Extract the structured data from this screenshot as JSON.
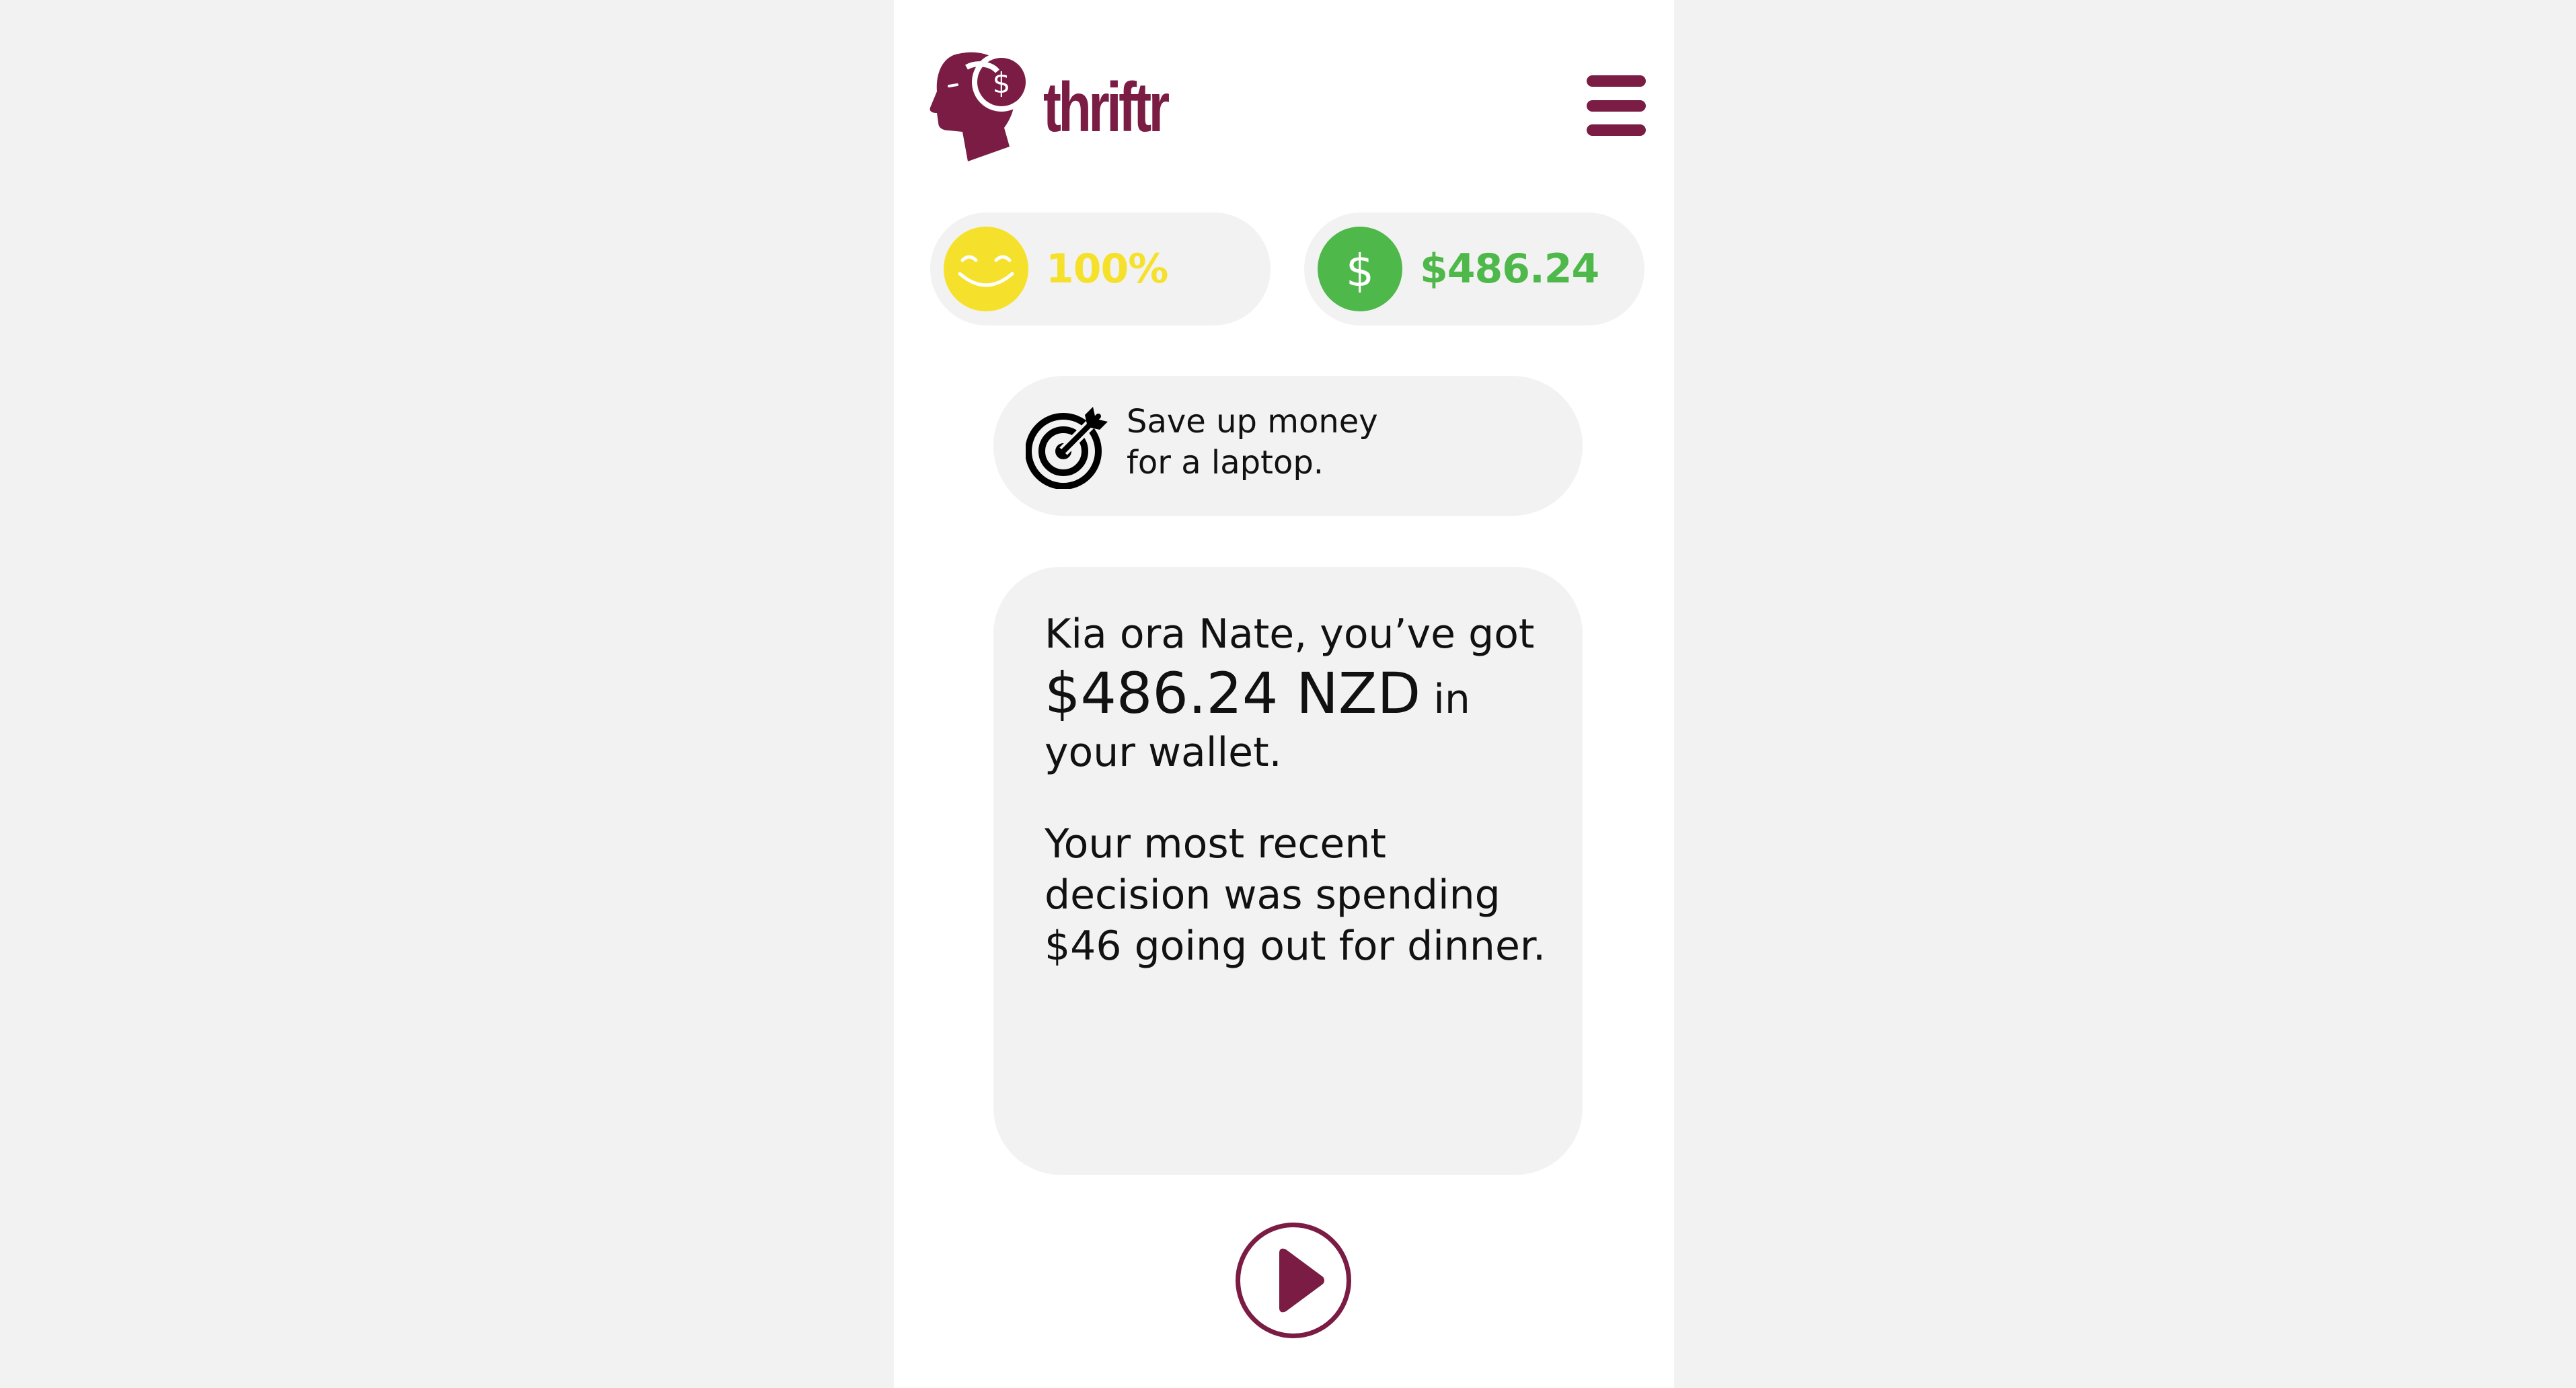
{
  "app": {
    "name": "thriftr"
  },
  "header": {
    "logo_icon": "head-with-dollar-icon",
    "menu_icon": "hamburger-menu-icon"
  },
  "stats": {
    "happiness": {
      "icon": "smiley-face-icon",
      "value": "100%",
      "color": "#f5e12c"
    },
    "wallet": {
      "icon": "dollar-coin-icon",
      "value": "$486.24",
      "color": "#4fb84a"
    }
  },
  "goal": {
    "icon": "target-dart-icon",
    "line1": "Save up money",
    "line2": "for a laptop."
  },
  "message": {
    "greeting": "Kia ora Nate, you’ve got",
    "amount": "$486.24 NZD",
    "in_text": "in",
    "wallet_text": "your wallet.",
    "recent_line1": "Your most recent",
    "recent_line2": "decision was spending",
    "recent_line3": "$46 going out for dinner."
  },
  "controls": {
    "play_icon": "play-icon"
  },
  "colors": {
    "brand": "#7a1c44",
    "background": "#f2f2f2",
    "surface": "#ffffff"
  }
}
